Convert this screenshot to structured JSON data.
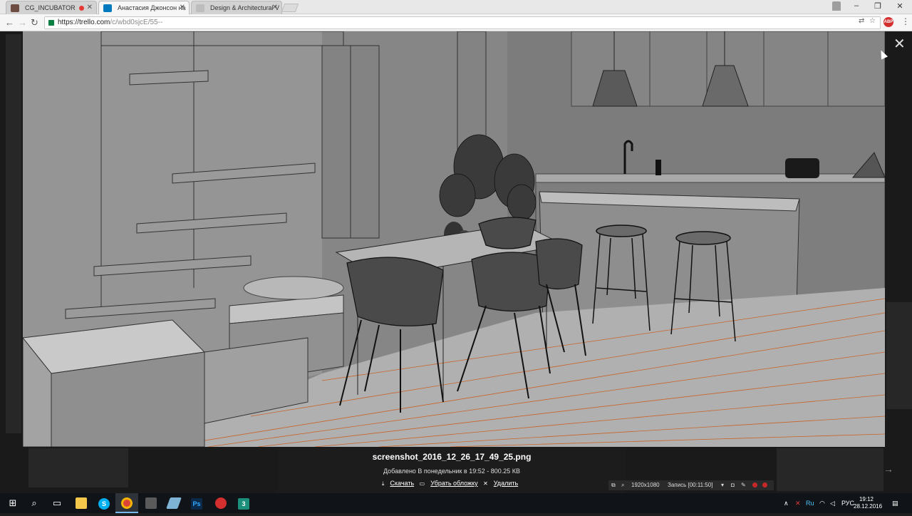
{
  "browser": {
    "tabs": [
      {
        "title": "CG_INCUBATOR",
        "recording": true
      },
      {
        "title": "Анастасия Джонсон на",
        "active": true
      },
      {
        "title": "Design & Architectural V"
      }
    ],
    "url_host": "https://trello.com",
    "url_path": "/c/wbd0sjcE/55--",
    "window_controls": [
      "minimize-icon",
      "restore-icon",
      "close-icon"
    ],
    "adblock_label": "ABP"
  },
  "viewer": {
    "filename": "screenshot_2016_12_26_17_49_25.png",
    "meta": "Добавлено В понедельник в 19:52 - 800.25 КВ",
    "actions": {
      "download": "Скачать",
      "remove_cover": "Убрать обложку",
      "delete": "Удалить"
    }
  },
  "recorder": {
    "resolution": "1920x1080",
    "status": "Запись [00:11:50]"
  },
  "taskbar": {
    "apps": [
      "start-icon",
      "search-icon",
      "task-view-icon",
      "file-explorer-icon",
      "skype-icon",
      "chrome-icon",
      "calculator-icon",
      "feather-icon",
      "photoshop-icon",
      "record-icon",
      "3dsmax-icon"
    ],
    "photoshop_label": "Ps",
    "skype_label": "S",
    "max_label": "3",
    "lang": "РУС",
    "ime": "Ru",
    "time": "19:12",
    "date": "28.12.2016"
  }
}
